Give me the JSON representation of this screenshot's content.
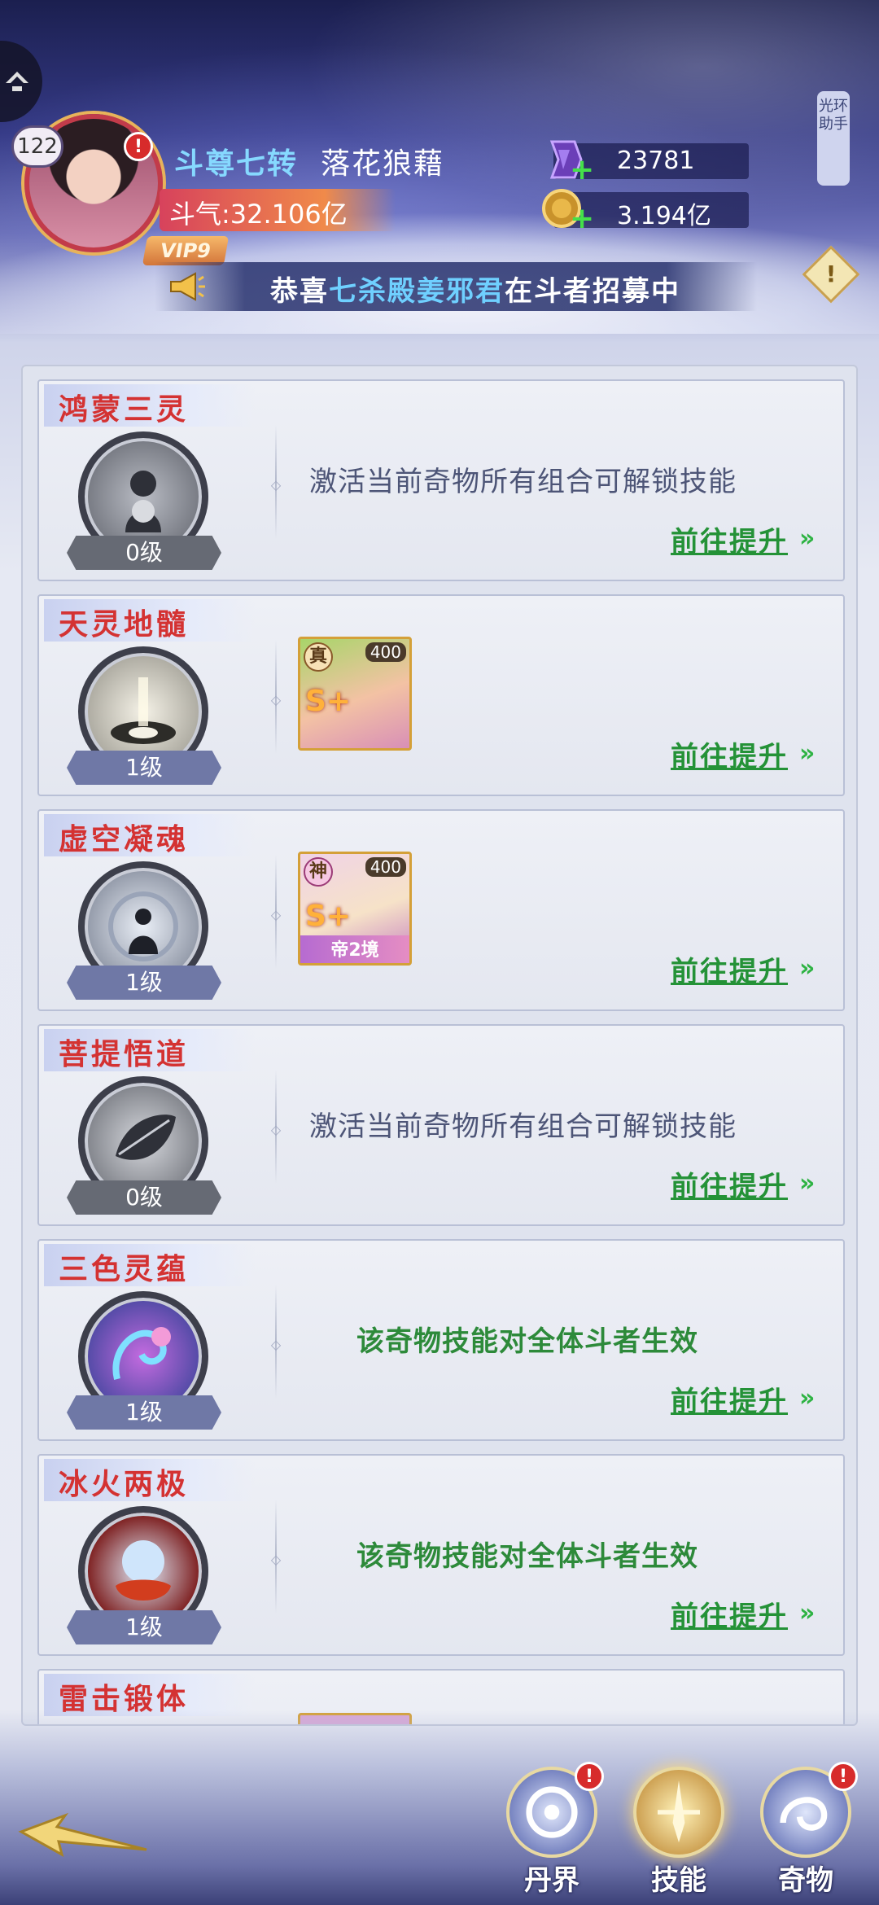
{
  "header": {
    "level": "122",
    "rank_title": "斗尊七转",
    "player_name": "落花狼藉",
    "power": "斗气:32.106亿",
    "vip": "VIP9",
    "gems": "23781",
    "gold": "3.194亿",
    "helper_label": "光环助手",
    "alert_mark": "!"
  },
  "marquee": {
    "prefix": "恭喜",
    "highlight": "七杀殿姜邪君",
    "suffix": "在斗者招募中"
  },
  "cards": [
    {
      "title": "鸿蒙三灵",
      "level": "0级",
      "desc": "激活当前奇物所有组合可解锁技能",
      "action": "前往提升"
    },
    {
      "title": "天灵地髓",
      "level": "1级",
      "action": "前往提升",
      "hero": {
        "badge": "真",
        "num": "400",
        "grade": "S+",
        "foot": ""
      }
    },
    {
      "title": "虚空凝魂",
      "level": "1级",
      "action": "前往提升",
      "hero": {
        "badge": "神",
        "num": "400",
        "grade": "S+",
        "foot": "帝2境"
      }
    },
    {
      "title": "菩提悟道",
      "level": "0级",
      "desc": "激活当前奇物所有组合可解锁技能",
      "action": "前往提升"
    },
    {
      "title": "三色灵蕴",
      "level": "1级",
      "desc": "该奇物技能对全体斗者生效",
      "action": "前往提升"
    },
    {
      "title": "冰火两极",
      "level": "1级",
      "desc": "该奇物技能对全体斗者生效",
      "action": "前往提升"
    },
    {
      "title": "雷击锻体"
    }
  ],
  "nav": [
    {
      "label": "丹界"
    },
    {
      "label": "技能"
    },
    {
      "label": "奇物"
    }
  ],
  "colors": {
    "title_red": "#d43232",
    "action_green": "#249237",
    "desc_green": "#2d8a3a"
  }
}
